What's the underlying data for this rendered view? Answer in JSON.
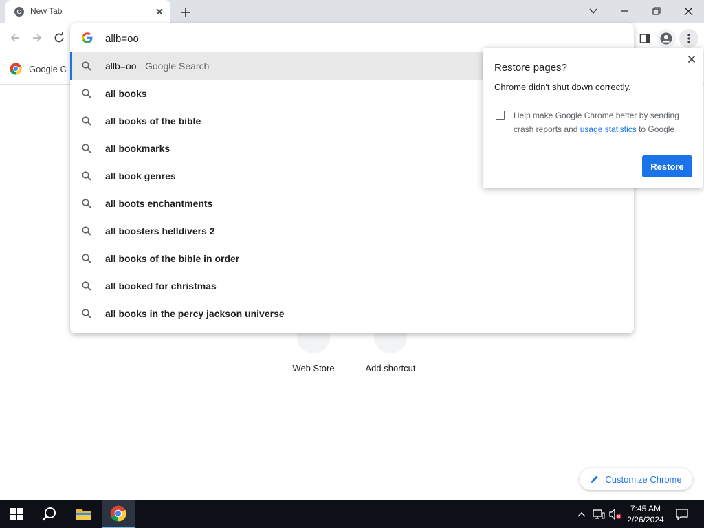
{
  "browser": {
    "tab_title": "New Tab",
    "omnibox_text": "allb=oo",
    "bookmark_label": "Google C"
  },
  "suggestions": [
    {
      "text": "allb=oo",
      "suffix": " - Google Search",
      "selected": true,
      "bold": false
    },
    {
      "text": "all books",
      "suffix": "",
      "selected": false,
      "bold": true
    },
    {
      "text": "all books of the bible",
      "suffix": "",
      "selected": false,
      "bold": true
    },
    {
      "text": "all bookmarks",
      "suffix": "",
      "selected": false,
      "bold": true
    },
    {
      "text": "all book genres",
      "suffix": "",
      "selected": false,
      "bold": true
    },
    {
      "text": "all boots enchantments",
      "suffix": "",
      "selected": false,
      "bold": true
    },
    {
      "text": "all boosters helldivers 2",
      "suffix": "",
      "selected": false,
      "bold": true
    },
    {
      "text": "all books of the bible in order",
      "suffix": "",
      "selected": false,
      "bold": true
    },
    {
      "text": "all booked for christmas",
      "suffix": "",
      "selected": false,
      "bold": true
    },
    {
      "text": "all books in the percy jackson universe",
      "suffix": "",
      "selected": false,
      "bold": true
    }
  ],
  "shortcuts": {
    "web_store": "Web Store",
    "add_shortcut": "Add shortcut"
  },
  "customize_label": "Customize Chrome",
  "restore_dialog": {
    "title": "Restore pages?",
    "message": "Chrome didn't shut down correctly.",
    "checkbox_text_before": "Help make Google Chrome better by sending crash reports and ",
    "checkbox_link": "usage statistics",
    "checkbox_text_after": " to Google",
    "button_label": "Restore"
  },
  "taskbar": {
    "time": "7:45 AM",
    "date": "2/26/2024"
  },
  "colors": {
    "accent": "#1a73e8",
    "tabstrip": "#dee1e6",
    "taskbar": "#0d1117"
  }
}
